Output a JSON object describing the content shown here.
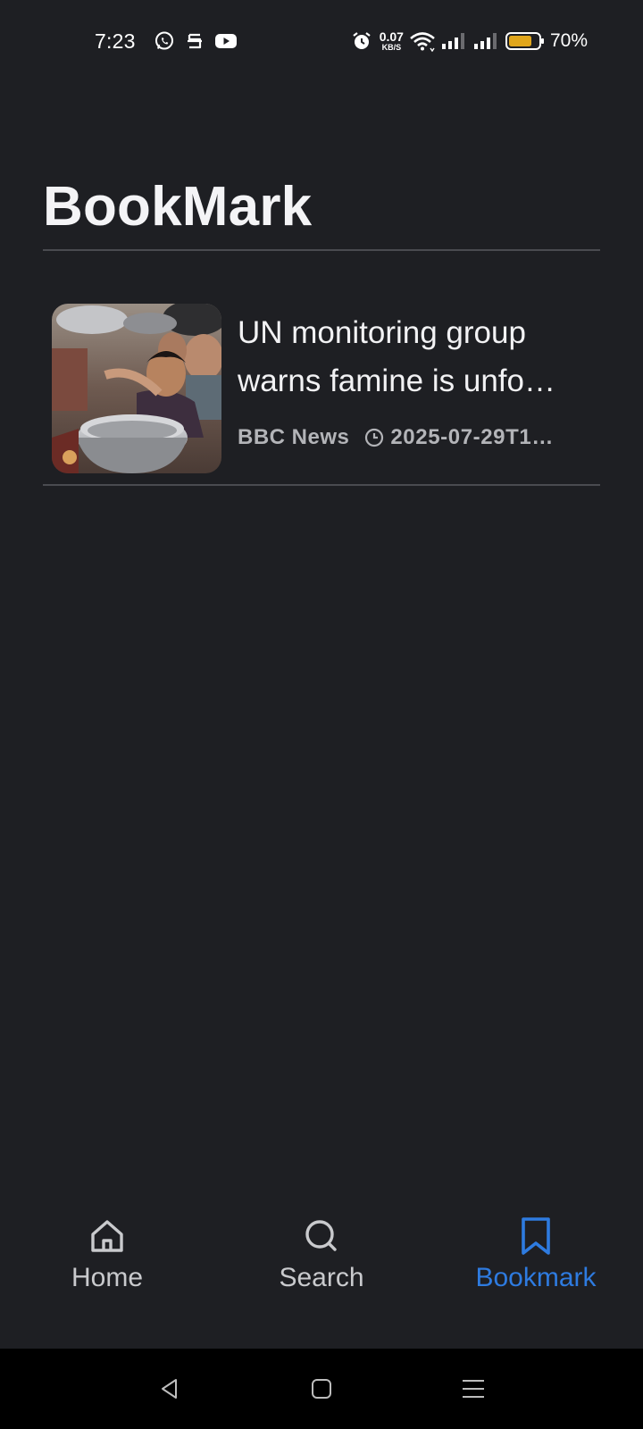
{
  "status_bar": {
    "time": "7:23",
    "net_speed_value": "0.07",
    "net_speed_unit": "KB/S",
    "battery_percent": "70%",
    "icons": [
      "whatsapp-icon",
      "app-notification-icon",
      "youtube-icon",
      "alarm-icon",
      "wifi-icon",
      "signal-icon",
      "signal-icon",
      "battery-icon"
    ]
  },
  "header": {
    "title": "BookMark"
  },
  "bookmarks": [
    {
      "title_line1": "UN monitoring group",
      "title_line2": "warns famine is unfo…",
      "source": "BBC News",
      "date": "2025-07-29T1…",
      "thumbnail": "news-photo"
    }
  ],
  "bottom_nav": {
    "items": [
      {
        "label": "Home",
        "icon": "home-icon",
        "active": false
      },
      {
        "label": "Search",
        "icon": "search-icon",
        "active": false
      },
      {
        "label": "Bookmark",
        "icon": "bookmark-icon",
        "active": true
      }
    ]
  },
  "colors": {
    "background": "#1e1f23",
    "accent": "#2e7be0",
    "text_primary": "#f2f2f4",
    "text_secondary": "#b3b4b8",
    "battery_fill": "#e0a61c"
  }
}
